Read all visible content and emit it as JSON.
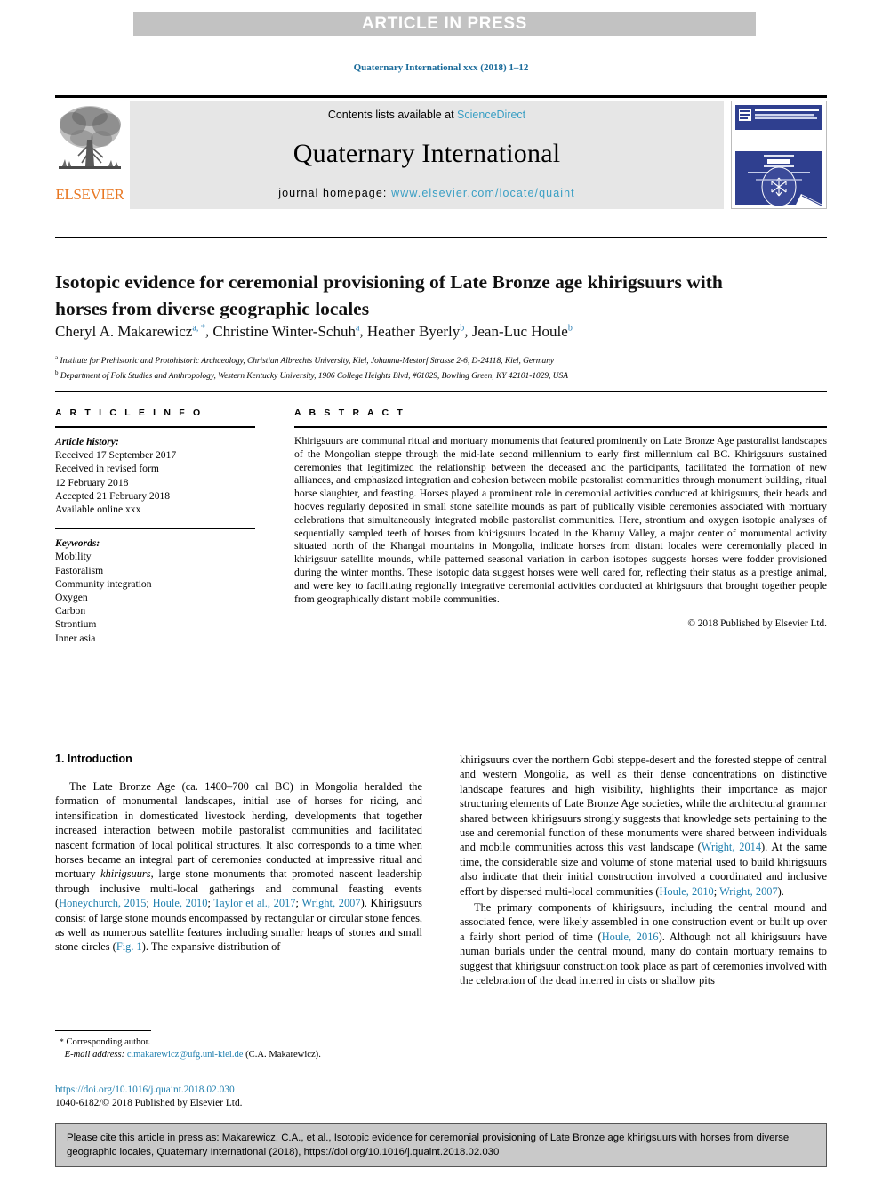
{
  "banner": {
    "text": "ARTICLE IN PRESS"
  },
  "running_head": "Quaternary International xxx (2018) 1–12",
  "masthead": {
    "publisher_name": "ELSEVIER",
    "contents_prefix": "Contents lists available at ",
    "sciencedirect": "ScienceDirect",
    "journal_name": "Quaternary International",
    "homepage_prefix": "journal homepage: ",
    "homepage_url": "www.elsevier.com/locate/quaint",
    "cover_title": "QUATERNARY INTERNATIONAL",
    "cover_subtitle": "THE JOURNAL OF THE INTERNATIONAL UNION FOR QUATERNARY RESEARCH",
    "accent_orange": "#e87722",
    "link_blue": "#3a9fc4"
  },
  "article": {
    "title": "Isotopic evidence for ceremonial provisioning of Late Bronze age khirigsuurs with horses from diverse geographic locales",
    "authors": [
      {
        "name": "Cheryl A. Makarewicz",
        "marks": "a, *"
      },
      {
        "name": "Christine Winter-Schuh",
        "marks": "a"
      },
      {
        "name": "Heather Byerly",
        "marks": "b"
      },
      {
        "name": "Jean-Luc Houle",
        "marks": "b"
      }
    ],
    "affiliations": [
      {
        "mark": "a",
        "text": "Institute for Prehistoric and Protohistoric Archaeology, Christian Albrechts University, Kiel, Johanna-Mestorf Strasse 2-6, D-24118, Kiel, Germany"
      },
      {
        "mark": "b",
        "text": "Department of Folk Studies and Anthropology, Western Kentucky University, 1906 College Heights Blvd, #61029, Bowling Green, KY 42101-1029, USA"
      }
    ]
  },
  "article_info": {
    "heading": "A R T I C L E   I N F O",
    "history_label": "Article history:",
    "history_lines": [
      "Received 17 September 2017",
      "Received in revised form",
      "12 February 2018",
      "Accepted 21 February 2018",
      "Available online xxx"
    ],
    "keywords_label": "Keywords:",
    "keywords": [
      "Mobility",
      "Pastoralism",
      "Community integration",
      "Oxygen",
      "Carbon",
      "Strontium",
      "Inner asia"
    ]
  },
  "abstract": {
    "heading": "A B S T R A C T",
    "text": "Khirigsuurs are communal ritual and mortuary monuments that featured prominently on Late Bronze Age pastoralist landscapes of the Mongolian steppe through the mid-late second millennium to early first millennium cal BC. Khirigsuurs sustained ceremonies that legitimized the relationship between the deceased and the participants, facilitated the formation of new alliances, and emphasized integration and cohesion between mobile pastoralist communities through monument building, ritual horse slaughter, and feasting. Horses played a prominent role in ceremonial activities conducted at khirigsuurs, their heads and hooves regularly deposited in small stone satellite mounds as part of publically visible ceremonies associated with mortuary celebrations that simultaneously integrated mobile pastoralist communities. Here, strontium and oxygen isotopic analyses of sequentially sampled teeth of horses from khirigsuurs located in the Khanuy Valley, a major center of monumental activity situated north of the Khangai mountains in Mongolia, indicate horses from distant locales were ceremonially placed in khirigsuur satellite mounds, while patterned seasonal variation in carbon isotopes suggests horses were fodder provisioned during the winter months. These isotopic data suggest horses were well cared for, reflecting their status as a prestige animal, and were key to facilitating regionally integrative ceremonial activities conducted at khirigsuurs that brought together people from geographically distant mobile communities.",
    "copyright": "© 2018 Published by Elsevier Ltd."
  },
  "body": {
    "section_number_title": "1.  Introduction",
    "left_paragraph_1": {
      "s1": "The Late Bronze Age (ca. 1400–700 cal BC) in Mongolia heralded the formation of monumental landscapes, initial use of horses for riding, and intensification in domesticated livestock herding, developments that together increased interaction between mobile pastoralist communities and facilitated nascent formation of local political structures. It also corresponds to a time when horses became an integral part of ceremonies conducted at impressive ritual and mortuary ",
      "ital1": "khirigsuurs",
      "s2": ", large stone monuments that promoted nascent leadership through inclusive multi-local gatherings and communal feasting events (",
      "ref1": "Honeychurch, 2015",
      "s3": "; ",
      "ref2": "Houle, 2010",
      "s4": "; ",
      "ref3": "Taylor et al., 2017",
      "s5": "; ",
      "ref4": "Wright, 2007",
      "s6": "). Khirigsuurs consist of large stone mounds encompassed by rectangular or circular stone fences, as well as numerous satellite features including smaller heaps of stones and small stone circles (",
      "ref5": "Fig. 1",
      "s7": "). The expansive distribution of"
    },
    "right_paragraph_1": {
      "s1": "khirigsuurs over the northern Gobi steppe-desert and the forested steppe of central and western Mongolia, as well as their dense concentrations on distinctive landscape features and high visibility, highlights their importance as major structuring elements of Late Bronze Age societies, while the architectural grammar shared between khirigsuurs strongly suggests that knowledge sets pertaining to the use and ceremonial function of these monuments were shared between individuals and mobile communities across this vast landscape (",
      "ref1": "Wright, 2014",
      "s2": "). At the same time, the considerable size and volume of stone material used to build khirigsuurs also indicate that their initial construction involved a coordinated and inclusive effort by dispersed multi-local communities (",
      "ref2": "Houle, 2010",
      "s3": "; ",
      "ref3": "Wright, 2007",
      "s4": ")."
    },
    "right_paragraph_2": {
      "s1": "The primary components of khirigsuurs, including the central mound and associated fence, were likely assembled in one construction event or built up over a fairly short period of time (",
      "ref1": "Houle, 2016",
      "s2": "). Although not all khirigsuurs have human burials under the central mound, many do contain mortuary remains to suggest that khirigsuur construction took place as part of ceremonies involved with the celebration of the dead interred in cists or shallow pits"
    }
  },
  "footnote": {
    "star": "*",
    "corresponding": "Corresponding author.",
    "email_label": "E-mail address:",
    "email": "c.makarewicz@ufg.uni-kiel.de",
    "email_owner": "(C.A. Makarewicz)."
  },
  "footer": {
    "doi_url": "https://doi.org/10.1016/j.quaint.2018.02.030",
    "issn_line": "1040-6182/© 2018 Published by Elsevier Ltd."
  },
  "citation_box": {
    "text": "Please cite this article in press as: Makarewicz, C.A., et al., Isotopic evidence for ceremonial provisioning of Late Bronze age khirigsuurs with horses from diverse geographic locales, Quaternary International (2018), https://doi.org/10.1016/j.quaint.2018.02.030"
  }
}
